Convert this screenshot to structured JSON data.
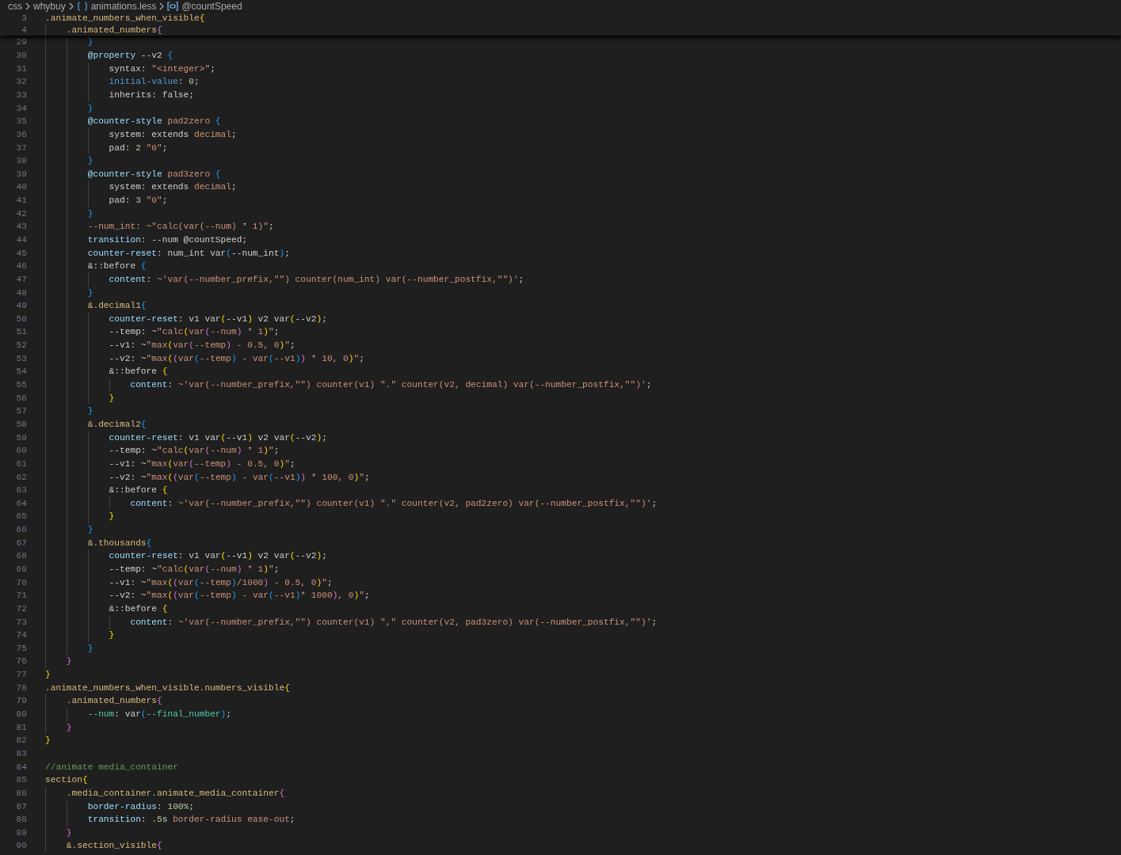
{
  "breadcrumb": [
    {
      "text": "css",
      "kind": "folder"
    },
    {
      "text": "whybuy",
      "kind": "folder"
    },
    {
      "text": "animations.less",
      "kind": "file"
    },
    {
      "text": "@countSpeed",
      "kind": "symbol"
    }
  ],
  "sticky_lines": [
    {
      "number": "3",
      "tokens": [
        {
          "text": ".animate_numbers_when_visible",
          "kind": "selector"
        },
        {
          "text": "{",
          "kind": "bracket1"
        }
      ]
    },
    {
      "number": "4",
      "tokens": [
        {
          "text": "    .animated_numbers",
          "kind": "selector"
        },
        {
          "text": "{",
          "kind": "bracket2"
        }
      ]
    }
  ],
  "lines": [
    {
      "number": "29",
      "tokens": [
        {
          "text": "        }",
          "kind": "bracket3"
        }
      ]
    },
    {
      "number": "30",
      "tokens": [
        {
          "text": "        @property",
          "kind": "property"
        },
        {
          "text": " --v2 ",
          "kind": "plain"
        },
        {
          "text": "{",
          "kind": "bracket3"
        }
      ]
    },
    {
      "number": "31",
      "tokens": [
        {
          "text": "            syntax: ",
          "kind": "plain"
        },
        {
          "text": "\"<integer>\"",
          "kind": "string"
        },
        {
          "text": ";",
          "kind": "plain"
        }
      ]
    },
    {
      "number": "32",
      "tokens": [
        {
          "text": "            initial-value",
          "kind": "keyword"
        },
        {
          "text": ": ",
          "kind": "plain"
        },
        {
          "text": "0",
          "kind": "number"
        },
        {
          "text": ";",
          "kind": "plain"
        }
      ]
    },
    {
      "number": "33",
      "tokens": [
        {
          "text": "            inherits: false;",
          "kind": "plain"
        }
      ]
    },
    {
      "number": "34",
      "tokens": [
        {
          "text": "        }",
          "kind": "bracket3"
        }
      ]
    },
    {
      "number": "35",
      "tokens": [
        {
          "text": "        @counter-style ",
          "kind": "property"
        },
        {
          "text": "pad2zero ",
          "kind": "string"
        },
        {
          "text": "{",
          "kind": "bracket3"
        }
      ]
    },
    {
      "number": "36",
      "tokens": [
        {
          "text": "            system: extends ",
          "kind": "plain"
        },
        {
          "text": "decimal",
          "kind": "string"
        },
        {
          "text": ";",
          "kind": "plain"
        }
      ]
    },
    {
      "number": "37",
      "tokens": [
        {
          "text": "            pad: ",
          "kind": "plain"
        },
        {
          "text": "2 ",
          "kind": "number"
        },
        {
          "text": "\"0\"",
          "kind": "string"
        },
        {
          "text": ";",
          "kind": "plain"
        }
      ]
    },
    {
      "number": "38",
      "tokens": [
        {
          "text": "        }",
          "kind": "bracket3"
        }
      ]
    },
    {
      "number": "39",
      "tokens": [
        {
          "text": "        @counter-style ",
          "kind": "property"
        },
        {
          "text": "pad3zero ",
          "kind": "string"
        },
        {
          "text": "{",
          "kind": "bracket3"
        }
      ]
    },
    {
      "number": "40",
      "tokens": [
        {
          "text": "            system: extends ",
          "kind": "plain"
        },
        {
          "text": "decimal",
          "kind": "string"
        },
        {
          "text": ";",
          "kind": "plain"
        }
      ]
    },
    {
      "number": "41",
      "tokens": [
        {
          "text": "            pad: ",
          "kind": "plain"
        },
        {
          "text": "3 ",
          "kind": "number"
        },
        {
          "text": "\"0\"",
          "kind": "string"
        },
        {
          "text": ";",
          "kind": "plain"
        }
      ]
    },
    {
      "number": "42",
      "tokens": [
        {
          "text": "        }",
          "kind": "bracket3"
        }
      ]
    },
    {
      "number": "43",
      "tokens": [
        {
          "text": "        --num_int: ~\"calc(var(--num) * 1)\"",
          "kind": "string"
        },
        {
          "text": ";",
          "kind": "plain"
        }
      ]
    },
    {
      "number": "44",
      "tokens": [
        {
          "text": "        transition",
          "kind": "property"
        },
        {
          "text": ": --num @countSpeed;",
          "kind": "plain"
        }
      ]
    },
    {
      "number": "45",
      "tokens": [
        {
          "text": "        counter-reset",
          "kind": "property"
        },
        {
          "text": ": num_int var",
          "kind": "plain"
        },
        {
          "text": "(",
          "kind": "bracket3"
        },
        {
          "text": "--num_int",
          "kind": "plain"
        },
        {
          "text": ")",
          "kind": "bracket3"
        },
        {
          "text": ";",
          "kind": "plain"
        }
      ]
    },
    {
      "number": "46",
      "tokens": [
        {
          "text": "        &::before ",
          "kind": "plain"
        },
        {
          "text": "{",
          "kind": "bracket3"
        }
      ]
    },
    {
      "number": "47",
      "tokens": [
        {
          "text": "            content",
          "kind": "property"
        },
        {
          "text": ": ",
          "kind": "plain"
        },
        {
          "text": "~'var(--number_prefix,\"\") counter(num_int) var(--number_postfix,\"\")'",
          "kind": "string"
        },
        {
          "text": ";",
          "kind": "plain"
        }
      ]
    },
    {
      "number": "48",
      "tokens": [
        {
          "text": "        }",
          "kind": "bracket3"
        }
      ]
    },
    {
      "number": "49",
      "tokens": [
        {
          "text": "        &.decimal1",
          "kind": "selector"
        },
        {
          "text": "{",
          "kind": "bracket3"
        }
      ]
    },
    {
      "number": "50",
      "tokens": [
        {
          "text": "            counter-reset",
          "kind": "property"
        },
        {
          "text": ": v1 var",
          "kind": "plain"
        },
        {
          "text": "(",
          "kind": "bracket1"
        },
        {
          "text": "--v1",
          "kind": "plain"
        },
        {
          "text": ")",
          "kind": "bracket1"
        },
        {
          "text": " v2 var",
          "kind": "plain"
        },
        {
          "text": "(",
          "kind": "bracket1"
        },
        {
          "text": "--v2",
          "kind": "plain"
        },
        {
          "text": ")",
          "kind": "bracket1"
        },
        {
          "text": ";",
          "kind": "plain"
        }
      ]
    },
    {
      "number": "51",
      "tokens": [
        {
          "text": "            --temp: ~",
          "kind": "plain"
        },
        {
          "text": "\"calc",
          "kind": "string"
        },
        {
          "text": "(",
          "kind": "bracket1"
        },
        {
          "text": "var",
          "kind": "string"
        },
        {
          "text": "(",
          "kind": "bracket2"
        },
        {
          "text": "--num",
          "kind": "string"
        },
        {
          "text": ")",
          "kind": "bracket2"
        },
        {
          "text": " * 1",
          "kind": "string"
        },
        {
          "text": ")",
          "kind": "bracket1"
        },
        {
          "text": "\"",
          "kind": "string"
        },
        {
          "text": ";",
          "kind": "plain"
        }
      ]
    },
    {
      "number": "52",
      "tokens": [
        {
          "text": "            --v1: ~",
          "kind": "plain"
        },
        {
          "text": "\"max",
          "kind": "string"
        },
        {
          "text": "(",
          "kind": "bracket1"
        },
        {
          "text": "var",
          "kind": "string"
        },
        {
          "text": "(",
          "kind": "bracket2"
        },
        {
          "text": "--temp",
          "kind": "string"
        },
        {
          "text": ")",
          "kind": "bracket2"
        },
        {
          "text": " - 0.5, 0",
          "kind": "string"
        },
        {
          "text": ")",
          "kind": "bracket1"
        },
        {
          "text": "\"",
          "kind": "string"
        },
        {
          "text": ";",
          "kind": "plain"
        }
      ]
    },
    {
      "number": "53",
      "tokens": [
        {
          "text": "            --v2: ~",
          "kind": "plain"
        },
        {
          "text": "\"max",
          "kind": "string"
        },
        {
          "text": "(",
          "kind": "bracket1"
        },
        {
          "text": "(",
          "kind": "bracket2"
        },
        {
          "text": "var",
          "kind": "string"
        },
        {
          "text": "(",
          "kind": "bracket3"
        },
        {
          "text": "--temp",
          "kind": "string"
        },
        {
          "text": ")",
          "kind": "bracket3"
        },
        {
          "text": " - var",
          "kind": "string"
        },
        {
          "text": "(",
          "kind": "bracket3"
        },
        {
          "text": "--v1",
          "kind": "string"
        },
        {
          "text": ")",
          "kind": "bracket3"
        },
        {
          "text": ")",
          "kind": "bracket2"
        },
        {
          "text": " * 10, 0",
          "kind": "string"
        },
        {
          "text": ")",
          "kind": "bracket1"
        },
        {
          "text": "\"",
          "kind": "string"
        },
        {
          "text": ";",
          "kind": "plain"
        }
      ]
    },
    {
      "number": "54",
      "tokens": [
        {
          "text": "            &::before ",
          "kind": "plain"
        },
        {
          "text": "{",
          "kind": "bracket1"
        }
      ]
    },
    {
      "number": "55",
      "tokens": [
        {
          "text": "                content",
          "kind": "property"
        },
        {
          "text": ": ",
          "kind": "plain"
        },
        {
          "text": "~'var(--number_prefix,\"\") counter(v1) \".\" counter(v2, decimal) var(--number_postfix,\"\")'",
          "kind": "string"
        },
        {
          "text": ";",
          "kind": "plain"
        }
      ]
    },
    {
      "number": "56",
      "tokens": [
        {
          "text": "            }",
          "kind": "bracket1"
        }
      ]
    },
    {
      "number": "57",
      "tokens": [
        {
          "text": "        }",
          "kind": "bracket3"
        }
      ]
    },
    {
      "number": "58",
      "tokens": [
        {
          "text": "        &.decimal2",
          "kind": "selector"
        },
        {
          "text": "{",
          "kind": "bracket3"
        }
      ]
    },
    {
      "number": "59",
      "tokens": [
        {
          "text": "            counter-reset",
          "kind": "property"
        },
        {
          "text": ": v1 var",
          "kind": "plain"
        },
        {
          "text": "(",
          "kind": "bracket1"
        },
        {
          "text": "--v1",
          "kind": "plain"
        },
        {
          "text": ")",
          "kind": "bracket1"
        },
        {
          "text": " v2 var",
          "kind": "plain"
        },
        {
          "text": "(",
          "kind": "bracket1"
        },
        {
          "text": "--v2",
          "kind": "plain"
        },
        {
          "text": ")",
          "kind": "bracket1"
        },
        {
          "text": ";",
          "kind": "plain"
        }
      ]
    },
    {
      "number": "60",
      "tokens": [
        {
          "text": "            --temp: ~",
          "kind": "plain"
        },
        {
          "text": "\"calc",
          "kind": "string"
        },
        {
          "text": "(",
          "kind": "bracket1"
        },
        {
          "text": "var",
          "kind": "string"
        },
        {
          "text": "(",
          "kind": "bracket2"
        },
        {
          "text": "--num",
          "kind": "string"
        },
        {
          "text": ")",
          "kind": "bracket2"
        },
        {
          "text": " * 1",
          "kind": "string"
        },
        {
          "text": ")",
          "kind": "bracket1"
        },
        {
          "text": "\"",
          "kind": "string"
        },
        {
          "text": ";",
          "kind": "plain"
        }
      ]
    },
    {
      "number": "61",
      "tokens": [
        {
          "text": "            --v1: ~",
          "kind": "plain"
        },
        {
          "text": "\"max",
          "kind": "string"
        },
        {
          "text": "(",
          "kind": "bracket1"
        },
        {
          "text": "var",
          "kind": "string"
        },
        {
          "text": "(",
          "kind": "bracket2"
        },
        {
          "text": "--temp",
          "kind": "string"
        },
        {
          "text": ")",
          "kind": "bracket2"
        },
        {
          "text": " - 0.5, 0",
          "kind": "string"
        },
        {
          "text": ")",
          "kind": "bracket1"
        },
        {
          "text": "\"",
          "kind": "string"
        },
        {
          "text": ";",
          "kind": "plain"
        }
      ]
    },
    {
      "number": "62",
      "tokens": [
        {
          "text": "            --v2: ~",
          "kind": "plain"
        },
        {
          "text": "\"max",
          "kind": "string"
        },
        {
          "text": "(",
          "kind": "bracket1"
        },
        {
          "text": "(",
          "kind": "bracket2"
        },
        {
          "text": "var",
          "kind": "string"
        },
        {
          "text": "(",
          "kind": "bracket3"
        },
        {
          "text": "--temp",
          "kind": "string"
        },
        {
          "text": ")",
          "kind": "bracket3"
        },
        {
          "text": " - var",
          "kind": "string"
        },
        {
          "text": "(",
          "kind": "bracket3"
        },
        {
          "text": "--v1",
          "kind": "string"
        },
        {
          "text": ")",
          "kind": "bracket3"
        },
        {
          "text": ")",
          "kind": "bracket2"
        },
        {
          "text": " * 100, 0",
          "kind": "string"
        },
        {
          "text": ")",
          "kind": "bracket1"
        },
        {
          "text": "\"",
          "kind": "string"
        },
        {
          "text": ";",
          "kind": "plain"
        }
      ]
    },
    {
      "number": "63",
      "tokens": [
        {
          "text": "            &::before ",
          "kind": "plain"
        },
        {
          "text": "{",
          "kind": "bracket1"
        }
      ]
    },
    {
      "number": "64",
      "tokens": [
        {
          "text": "                content",
          "kind": "property"
        },
        {
          "text": ": ",
          "kind": "plain"
        },
        {
          "text": "~'var(--number_prefix,\"\") counter(v1) \".\" counter(v2, pad2zero) var(--number_postfix,\"\")'",
          "kind": "string"
        },
        {
          "text": ";",
          "kind": "plain"
        }
      ]
    },
    {
      "number": "65",
      "tokens": [
        {
          "text": "            }",
          "kind": "bracket1"
        }
      ]
    },
    {
      "number": "66",
      "tokens": [
        {
          "text": "        }",
          "kind": "bracket3"
        }
      ]
    },
    {
      "number": "67",
      "tokens": [
        {
          "text": "        &.thousands",
          "kind": "selector"
        },
        {
          "text": "{",
          "kind": "bracket3"
        }
      ]
    },
    {
      "number": "68",
      "tokens": [
        {
          "text": "            counter-reset",
          "kind": "property"
        },
        {
          "text": ": v1 var",
          "kind": "plain"
        },
        {
          "text": "(",
          "kind": "bracket1"
        },
        {
          "text": "--v1",
          "kind": "plain"
        },
        {
          "text": ")",
          "kind": "bracket1"
        },
        {
          "text": " v2 var",
          "kind": "plain"
        },
        {
          "text": "(",
          "kind": "bracket1"
        },
        {
          "text": "--v2",
          "kind": "plain"
        },
        {
          "text": ")",
          "kind": "bracket1"
        },
        {
          "text": ";",
          "kind": "plain"
        }
      ]
    },
    {
      "number": "69",
      "tokens": [
        {
          "text": "            --temp: ~",
          "kind": "plain"
        },
        {
          "text": "\"calc",
          "kind": "string"
        },
        {
          "text": "(",
          "kind": "bracket1"
        },
        {
          "text": "var",
          "kind": "string"
        },
        {
          "text": "(",
          "kind": "bracket2"
        },
        {
          "text": "--num",
          "kind": "string"
        },
        {
          "text": ")",
          "kind": "bracket2"
        },
        {
          "text": " * 1",
          "kind": "string"
        },
        {
          "text": ")",
          "kind": "bracket1"
        },
        {
          "text": "\"",
          "kind": "string"
        },
        {
          "text": ";",
          "kind": "plain"
        }
      ]
    },
    {
      "number": "70",
      "tokens": [
        {
          "text": "            --v1: ~",
          "kind": "plain"
        },
        {
          "text": "\"max",
          "kind": "string"
        },
        {
          "text": "(",
          "kind": "bracket1"
        },
        {
          "text": "(",
          "kind": "bracket2"
        },
        {
          "text": "var",
          "kind": "string"
        },
        {
          "text": "(",
          "kind": "bracket3"
        },
        {
          "text": "--temp",
          "kind": "string"
        },
        {
          "text": ")",
          "kind": "bracket3"
        },
        {
          "text": "/1000",
          "kind": "string"
        },
        {
          "text": ")",
          "kind": "bracket2"
        },
        {
          "text": " - 0.5, 0",
          "kind": "string"
        },
        {
          "text": ")",
          "kind": "bracket1"
        },
        {
          "text": "\"",
          "kind": "string"
        },
        {
          "text": ";",
          "kind": "plain"
        }
      ]
    },
    {
      "number": "71",
      "tokens": [
        {
          "text": "            --v2: ~",
          "kind": "plain"
        },
        {
          "text": "\"max",
          "kind": "string"
        },
        {
          "text": "(",
          "kind": "bracket1"
        },
        {
          "text": "(",
          "kind": "bracket2"
        },
        {
          "text": "var",
          "kind": "string"
        },
        {
          "text": "(",
          "kind": "bracket3"
        },
        {
          "text": "--temp",
          "kind": "string"
        },
        {
          "text": ")",
          "kind": "bracket3"
        },
        {
          "text": " - var",
          "kind": "string"
        },
        {
          "text": "(",
          "kind": "bracket3"
        },
        {
          "text": "--v1",
          "kind": "string"
        },
        {
          "text": ")",
          "kind": "bracket3"
        },
        {
          "text": "* 1000",
          "kind": "string"
        },
        {
          "text": ")",
          "kind": "bracket2"
        },
        {
          "text": ", 0",
          "kind": "string"
        },
        {
          "text": ")",
          "kind": "bracket1"
        },
        {
          "text": "\"",
          "kind": "string"
        },
        {
          "text": ";",
          "kind": "plain"
        }
      ]
    },
    {
      "number": "72",
      "tokens": [
        {
          "text": "            &::before ",
          "kind": "plain"
        },
        {
          "text": "{",
          "kind": "bracket1"
        }
      ]
    },
    {
      "number": "73",
      "tokens": [
        {
          "text": "                content",
          "kind": "property"
        },
        {
          "text": ": ",
          "kind": "plain"
        },
        {
          "text": "~'var(--number_prefix,\"\") counter(v1) \",\" counter(v2, pad3zero) var(--number_postfix,\"\")'",
          "kind": "string"
        },
        {
          "text": ";",
          "kind": "plain"
        }
      ]
    },
    {
      "number": "74",
      "tokens": [
        {
          "text": "            }",
          "kind": "bracket1"
        }
      ]
    },
    {
      "number": "75",
      "tokens": [
        {
          "text": "        }",
          "kind": "bracket3"
        }
      ]
    },
    {
      "number": "76",
      "tokens": [
        {
          "text": "    }",
          "kind": "bracket2"
        }
      ]
    },
    {
      "number": "77",
      "tokens": [
        {
          "text": "}",
          "kind": "bracket1"
        }
      ]
    },
    {
      "number": "78",
      "tokens": [
        {
          "text": ".animate_numbers_when_visible.numbers_visible",
          "kind": "selector"
        },
        {
          "text": "{",
          "kind": "bracket1"
        }
      ]
    },
    {
      "number": "79",
      "tokens": [
        {
          "text": "    .animated_numbers",
          "kind": "selector"
        },
        {
          "text": "{",
          "kind": "bracket2"
        }
      ]
    },
    {
      "number": "80",
      "tokens": [
        {
          "text": "        --num",
          "kind": "variable"
        },
        {
          "text": ": var",
          "kind": "plain"
        },
        {
          "text": "(",
          "kind": "bracket3"
        },
        {
          "text": "--final_number",
          "kind": "variable"
        },
        {
          "text": ")",
          "kind": "bracket3"
        },
        {
          "text": ";",
          "kind": "plain"
        }
      ]
    },
    {
      "number": "81",
      "tokens": [
        {
          "text": "    }",
          "kind": "bracket2"
        }
      ]
    },
    {
      "number": "82",
      "tokens": [
        {
          "text": "}",
          "kind": "bracket1"
        }
      ]
    },
    {
      "number": "83"
    },
    {
      "number": "84",
      "tokens": [
        {
          "text": "//animate media_container",
          "kind": "comment"
        }
      ]
    },
    {
      "number": "85",
      "tokens": [
        {
          "text": "section",
          "kind": "selector"
        },
        {
          "text": "{",
          "kind": "bracket1"
        }
      ]
    },
    {
      "number": "86",
      "tokens": [
        {
          "text": "    .media_container.animate_media_container",
          "kind": "selector"
        },
        {
          "text": "{",
          "kind": "bracket2"
        }
      ]
    },
    {
      "number": "87",
      "tokens": [
        {
          "text": "        border-radius",
          "kind": "property"
        },
        {
          "text": ": ",
          "kind": "plain"
        },
        {
          "text": "100%",
          "kind": "number"
        },
        {
          "text": ";",
          "kind": "plain"
        }
      ]
    },
    {
      "number": "88",
      "tokens": [
        {
          "text": "        transition",
          "kind": "property"
        },
        {
          "text": ": ",
          "kind": "plain"
        },
        {
          "text": ".5s ",
          "kind": "number"
        },
        {
          "text": "border-radius ease-out",
          "kind": "string"
        },
        {
          "text": ";",
          "kind": "plain"
        }
      ]
    },
    {
      "number": "89",
      "tokens": [
        {
          "text": "    }",
          "kind": "bracket2"
        }
      ]
    },
    {
      "number": "90",
      "tokens": [
        {
          "text": "    &.section_visible",
          "kind": "selector"
        },
        {
          "text": "{",
          "kind": "bracket2"
        }
      ]
    }
  ]
}
